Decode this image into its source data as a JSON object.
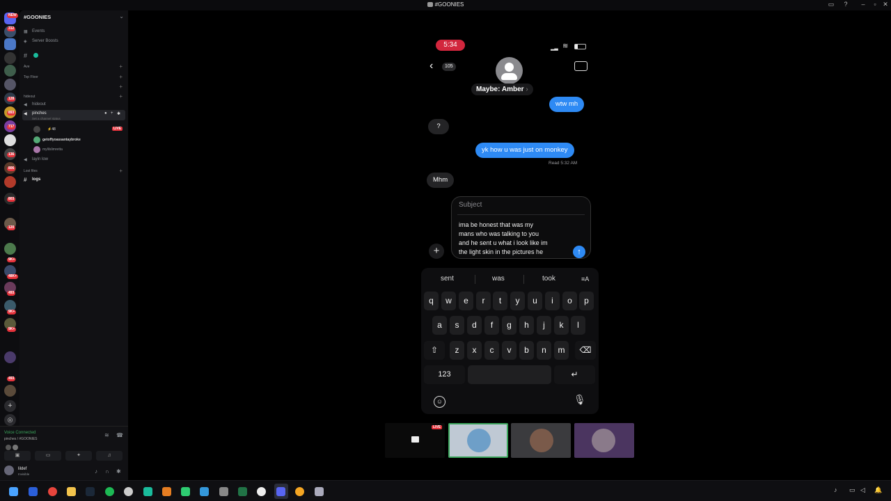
{
  "window": {
    "title": "#GOONIES"
  },
  "server_rail": {
    "badges": [
      "NEW",
      "312",
      "128",
      "893",
      "717",
      "136",
      "806",
      "803",
      "120",
      "9K+",
      "48K+",
      "493",
      "9K+",
      "9K+",
      "493"
    ]
  },
  "sidebar": {
    "server_name": "#GOONIES",
    "events": "Events",
    "server_boosts": "Server Boosts",
    "categories": {
      "ave": "Ave",
      "top_floor": "Top Floor",
      "hideout": "hideout",
      "lost_files": "Lost files"
    },
    "channels": {
      "hideout": "hideout",
      "pinches": "pinches",
      "pinches_status": "Set a channel status",
      "layin_low": "layin low",
      "logs": "logs"
    },
    "voice_members": [
      {
        "name": "⚡48",
        "live": "LIVE"
      },
      {
        "name": "getoffyoassantaybroke"
      },
      {
        "name": "mylilslimretta"
      }
    ]
  },
  "voice_panel": {
    "status": "Voice Connected",
    "channel": "pinches / #GOONIES",
    "user_name": "lildef",
    "user_status": "Invisible"
  },
  "phone": {
    "time": "5:34",
    "back_count": "105",
    "contact_name": "Maybe: Amber",
    "messages": [
      {
        "side": "out",
        "text": "wtw mh"
      },
      {
        "side": "in",
        "text": "?"
      },
      {
        "side": "out",
        "text": "yk how u was just on monkey"
      },
      {
        "side": "in",
        "text": "Mhm"
      }
    ],
    "read_receipt": "Read 5:32 AM",
    "compose": {
      "subject": "Subject",
      "lines": [
        "ima be honest that was my",
        "mans who was talking to you",
        "and he sent u what i look like im",
        "the light skin in the pictures he"
      ]
    },
    "suggestions": [
      "sent",
      "was",
      "took"
    ],
    "keyboard": {
      "row1": [
        "q",
        "w",
        "e",
        "r",
        "t",
        "y",
        "u",
        "i",
        "o",
        "p"
      ],
      "row2": [
        "a",
        "s",
        "d",
        "f",
        "g",
        "h",
        "j",
        "k",
        "l"
      ],
      "row3": [
        "z",
        "x",
        "c",
        "v",
        "b",
        "n",
        "m"
      ],
      "numbers_key": "123"
    }
  },
  "stream_tiles": {
    "live_badge": "LIVE"
  },
  "colors": {
    "imessage_blue": "#2e8af4",
    "live_red": "#d2263d",
    "voice_green": "#3ba55c"
  }
}
